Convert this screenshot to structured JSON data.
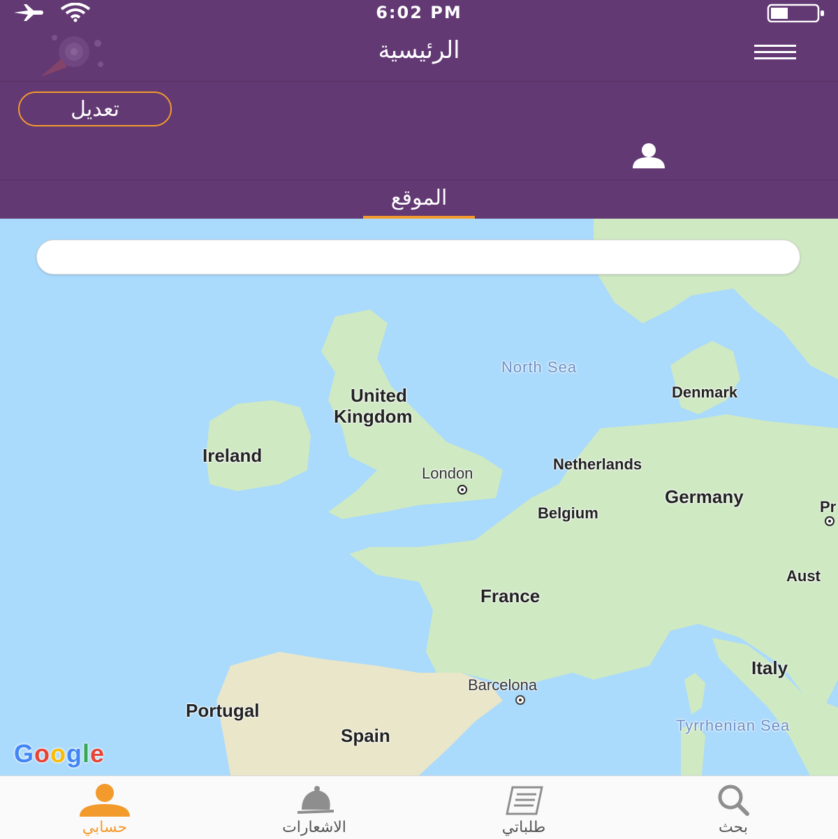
{
  "status_bar": {
    "time": "6:02 PM",
    "icons": [
      "airplane-icon",
      "wifi-icon",
      "battery-icon"
    ]
  },
  "header": {
    "title": "الرئيسية",
    "menu_icon": "hamburger-icon",
    "logo": "app-logo"
  },
  "profile": {
    "edit_label": "تعديل",
    "avatar_icon": "user-icon"
  },
  "tabs": {
    "location_label": "الموقع"
  },
  "map": {
    "search_placeholder": "",
    "labels": {
      "north_sea": "North Sea",
      "denmark": "Denmark",
      "united": "United",
      "kingdom": "Kingdom",
      "ireland": "Ireland",
      "london": "London",
      "netherlands": "Netherlands",
      "germany": "Germany",
      "belgium": "Belgium",
      "france": "France",
      "austria": "Aust",
      "prague": "Pr",
      "italy": "Italy",
      "barcelona": "Barcelona",
      "tyrrhenian_sea": "Tyrrhenian Sea",
      "portugal": "Portugal",
      "spain": "Spain"
    },
    "attribution": "Google"
  },
  "colors": {
    "header_purple": "#623973",
    "accent_orange": "#f39a2c",
    "water": "#aadafc",
    "land": "#cfe9c3"
  },
  "tabbar": {
    "items": [
      {
        "label": "حسابي",
        "icon": "user-icon",
        "active": true
      },
      {
        "label": "الاشعارات",
        "icon": "bell-icon",
        "active": false
      },
      {
        "label": "طلباتي",
        "icon": "orders-icon",
        "active": false
      },
      {
        "label": "بحث",
        "icon": "search-icon",
        "active": false
      }
    ]
  }
}
